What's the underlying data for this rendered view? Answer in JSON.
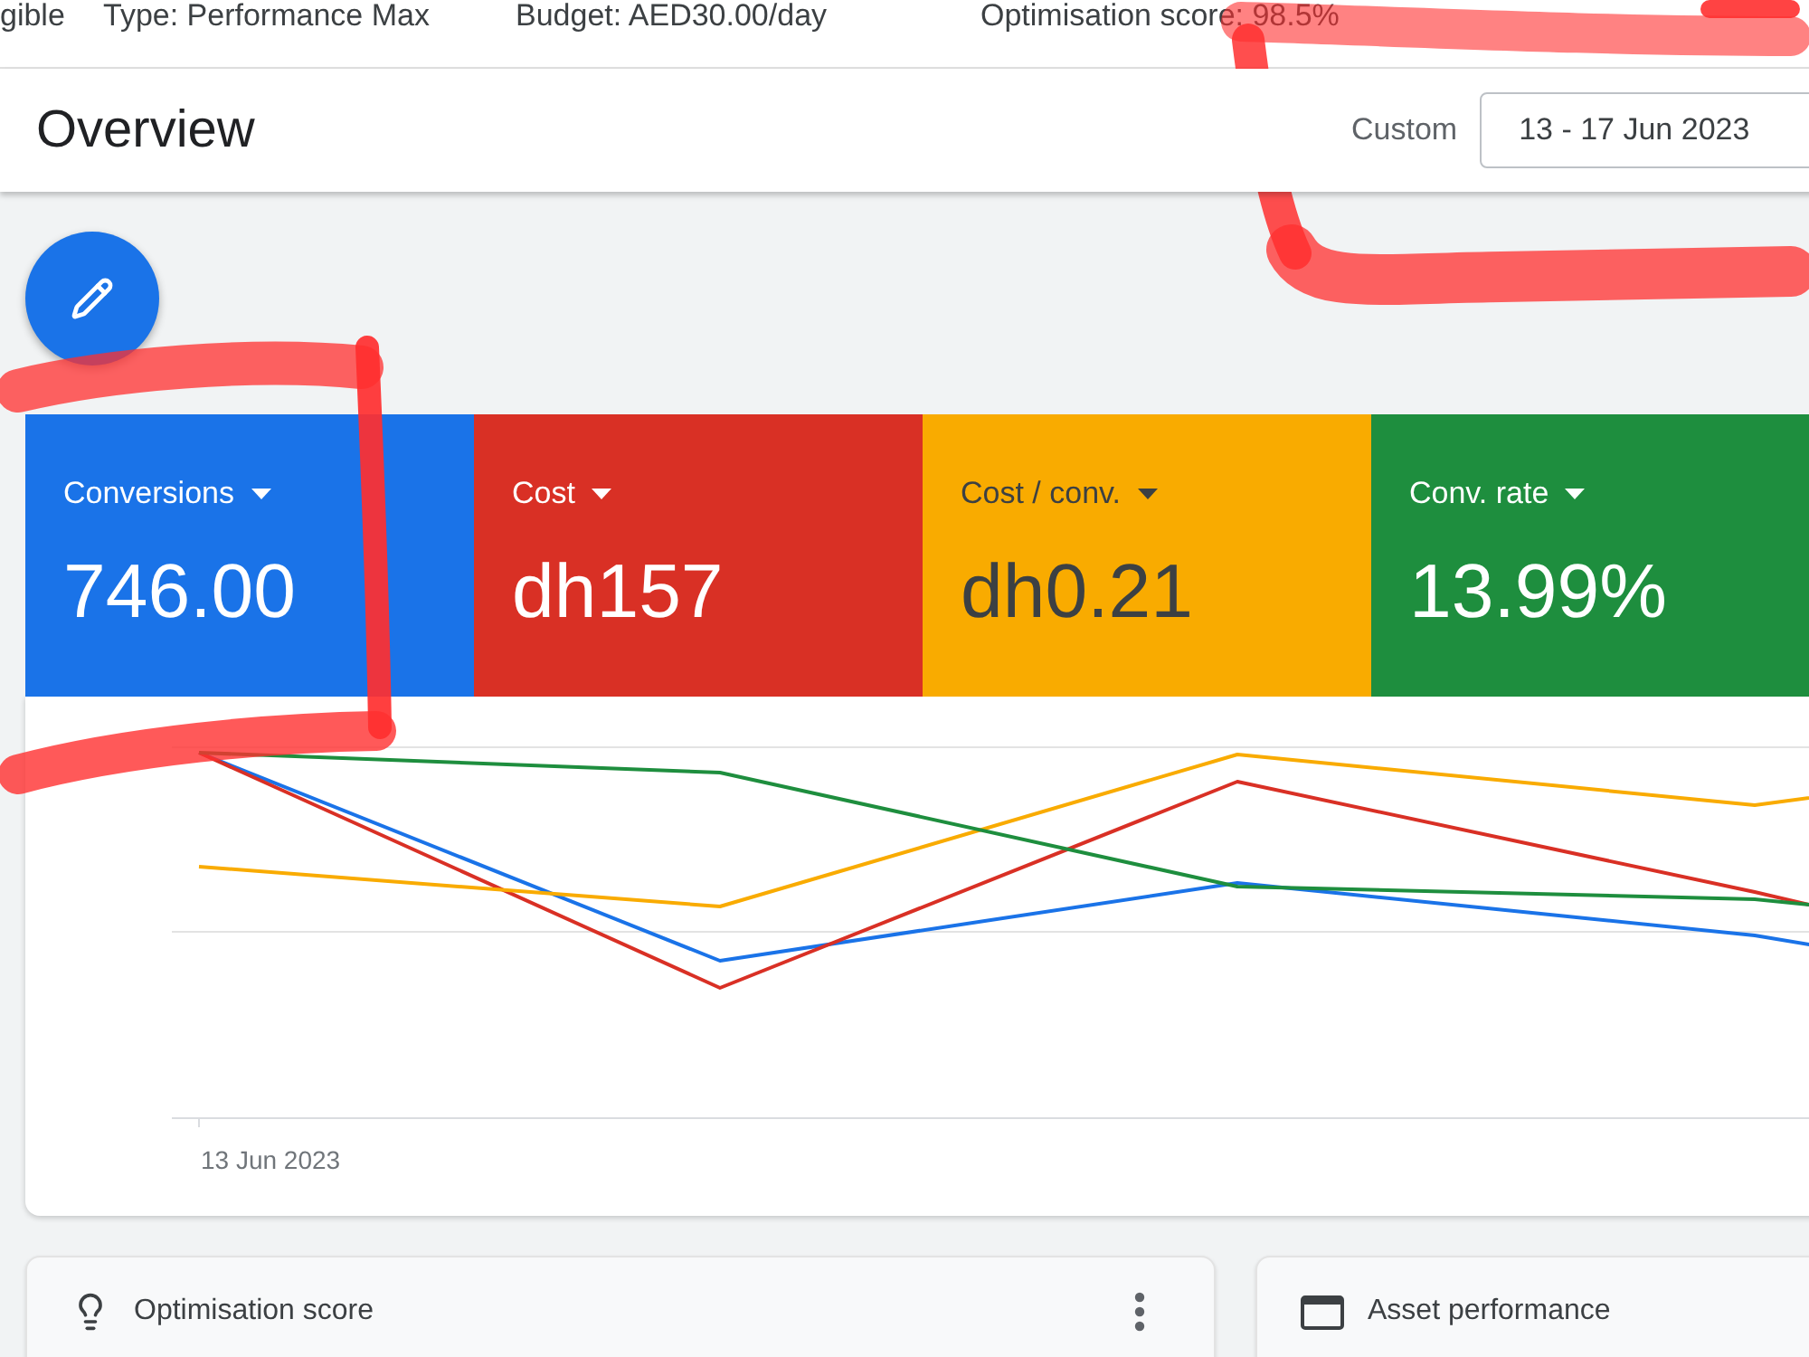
{
  "summary_bar": {
    "items": [
      "gible",
      "Type: Performance Max",
      "Budget: AED30.00/day",
      "Optimisation score: 98.5%"
    ]
  },
  "header": {
    "title": "Overview",
    "date_range": {
      "label": "Custom",
      "value": "13 - 17 Jun 2023"
    }
  },
  "metrics": [
    {
      "label": "Conversions",
      "value": "746.00",
      "color": "#1a73e8"
    },
    {
      "label": "Cost",
      "value": "dh157",
      "color": "#d93025"
    },
    {
      "label": "Cost / conv.",
      "value": "dh0.21",
      "color": "#f9ab00"
    },
    {
      "label": "Conv. rate",
      "value": "13.99%",
      "color": "#1e8e3e"
    }
  ],
  "chart": {
    "x_axis_label": "13 Jun 2023"
  },
  "cards": [
    {
      "kind": "score",
      "title": "Optimisation score"
    },
    {
      "kind": "assets",
      "title": "Asset performance"
    }
  ]
}
